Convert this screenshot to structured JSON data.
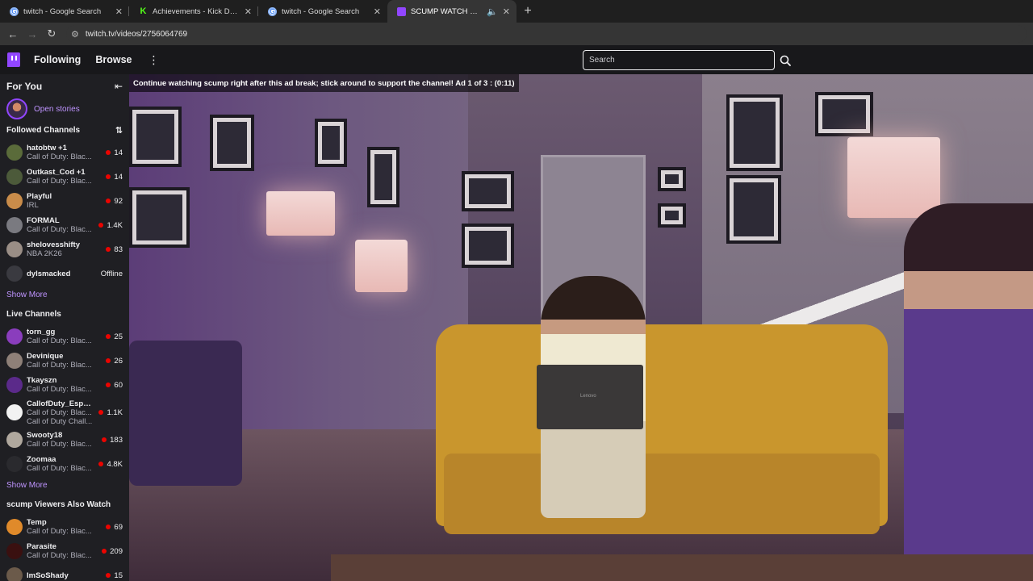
{
  "browser": {
    "tabs": [
      {
        "title": "twitch - Google Search",
        "favicon": "google-icon"
      },
      {
        "title": "Achievements - Kick Dashboard",
        "favicon": "kick-icon"
      },
      {
        "title": "twitch - Google Search",
        "favicon": "google-icon"
      },
      {
        "title": "SCUMP WATCH PARTY!! RI",
        "favicon": "twitch-icon",
        "active": true
      }
    ],
    "url": "twitch.tv/videos/2756064769"
  },
  "topnav": {
    "following": "Following",
    "browse": "Browse",
    "search_placeholder": "Search"
  },
  "sidebar": {
    "for_you": "For You",
    "open_stories": "Open stories",
    "followed_title": "Followed Channels",
    "followed": [
      {
        "name": "hatobtw +1",
        "game": "Call of Duty: Blac...",
        "viewers": "14",
        "color": "#5a6b3a"
      },
      {
        "name": "Outkast_Cod +1",
        "game": "Call of Duty: Blac...",
        "viewers": "14",
        "color": "#4c5a3a"
      },
      {
        "name": "Playful",
        "game": "IRL",
        "viewers": "92",
        "color": "#c98c4a"
      },
      {
        "name": "FORMAL",
        "game": "Call of Duty: Blac...",
        "viewers": "1.4K",
        "color": "#7a7a80"
      },
      {
        "name": "shelovesshifty",
        "game": "NBA 2K26",
        "viewers": "83",
        "color": "#9a8e86"
      }
    ],
    "offline_channel": {
      "name": "dylsmacked",
      "status": "Offline"
    },
    "show_more_1": "Show More",
    "live_title": "Live Channels",
    "live": [
      {
        "name": "torn_gg",
        "game": "Call of Duty: Blac...",
        "viewers": "25",
        "color": "#8a3dbd"
      },
      {
        "name": "Devinique",
        "game": "Call of Duty: Blac...",
        "viewers": "26",
        "color": "#8e8078"
      },
      {
        "name": "Tkayszn",
        "game": "Call of Duty: Blac...",
        "viewers": "60",
        "color": "#5b2a8a"
      },
      {
        "name": "CallofDuty_Esports",
        "game": "Call of Duty: Blac...",
        "game2": "Call of Duty Chall...",
        "viewers": "1.1K",
        "color": "#f2f2f2"
      },
      {
        "name": "Swooty18",
        "game": "Call of Duty: Blac...",
        "viewers": "183",
        "color": "#b0a89e"
      },
      {
        "name": "Zoomaa",
        "game": "Call of Duty: Blac...",
        "viewers": "4.8K",
        "color": "#2a2a2e"
      }
    ],
    "show_more_2": "Show More",
    "also_watch_title": "scump Viewers Also Watch",
    "also_watch": [
      {
        "name": "Temp",
        "game": "Call of Duty: Blac...",
        "viewers": "69",
        "color": "#e08a2a"
      },
      {
        "name": "Parasite",
        "game": "Call of Duty: Blac...",
        "viewers": "209",
        "color": "#3a1010"
      },
      {
        "name": "ImSoShady",
        "game": "",
        "viewers": "15",
        "color": "#6b5a4a"
      }
    ]
  },
  "video": {
    "ad_text": "Continue watching scump right after this ad break; stick around to support the channel! Ad 1 of 3 : (0:11)",
    "laptop_brand": "Lenovo"
  }
}
